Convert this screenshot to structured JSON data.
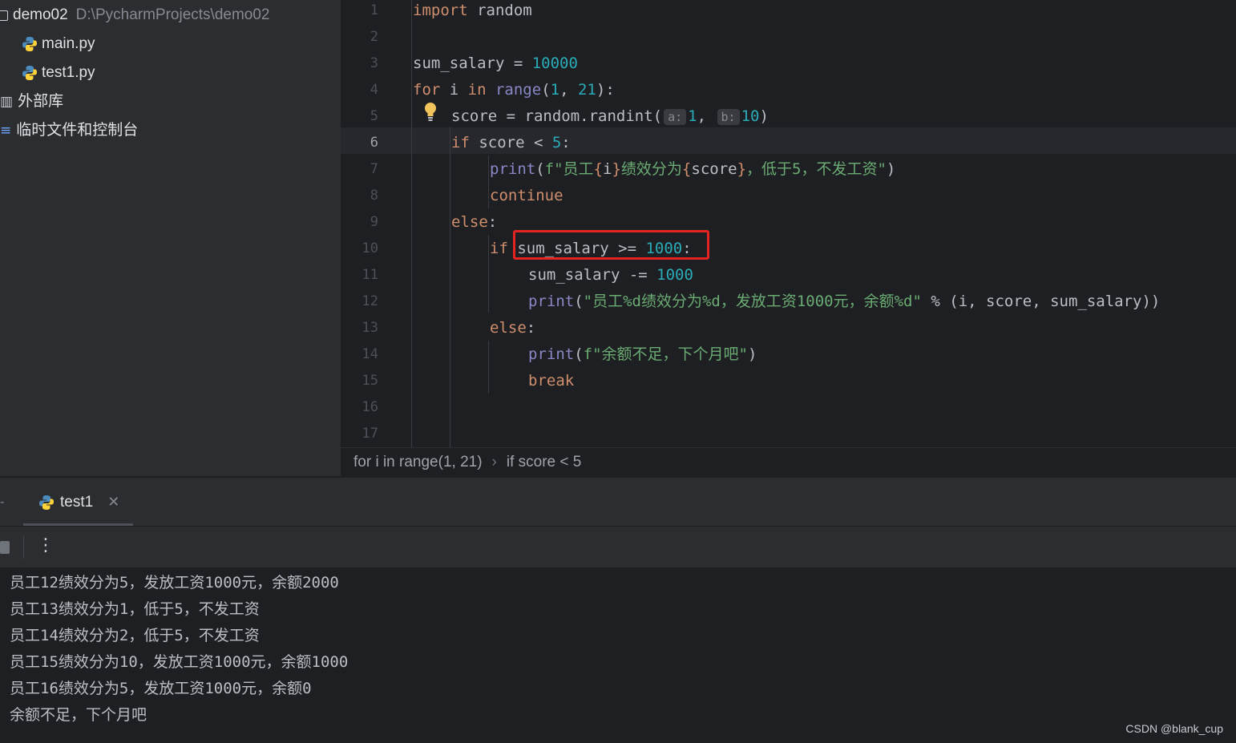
{
  "project": {
    "root_name": "demo02",
    "root_path": "D:\\PycharmProjects\\demo02",
    "files": [
      "main.py",
      "test1.py"
    ],
    "external_libraries": "外部库",
    "scratches": "临时文件和控制台"
  },
  "editor": {
    "line_numbers": [
      "1",
      "2",
      "3",
      "4",
      "5",
      "6",
      "7",
      "8",
      "9",
      "10",
      "11",
      "12",
      "13",
      "14",
      "15",
      "16",
      "17"
    ],
    "active_line": "6",
    "code": {
      "l1_kw": "import",
      "l1_rest": " random",
      "l3_var": "sum_salary",
      "l3_op": " = ",
      "l3_num": "10000",
      "l4_for": "for",
      "l4_i": " i ",
      "l4_in": "in",
      "l4_range": " range",
      "l4_open": "(",
      "l4_n1": "1",
      "l4_comma": ", ",
      "l4_n2": "21",
      "l4_close": "):",
      "l5_pre": "score = random.randint(",
      "l5_hint_a": "a:",
      "l5_n1": "1",
      "l5_comma": ",",
      "l5_hint_b": "b:",
      "l5_n2": "10",
      "l5_close": ")",
      "l6_if": "if",
      "l6_mid": " score < ",
      "l6_num": "5",
      "l6_colon": ":",
      "l7_print": "print",
      "l7_open": "(",
      "l7_f": "f\"员工",
      "l7_b1": "{",
      "l7_v1": "i",
      "l7_b2": "}",
      "l7_mid": "绩效分为",
      "l7_b3": "{",
      "l7_v2": "score",
      "l7_b4": "}",
      "l7_tail": "，低于5，不发工资\"",
      "l7_close": ")",
      "l8_kw": "continue",
      "l9_kw": "else",
      "l9_colon": ":",
      "l10_if": "if",
      "l10_cond": " sum_salary >= ",
      "l10_num": "1000",
      "l10_colon": ":",
      "l11_pre": "sum_salary -= ",
      "l11_num": "1000",
      "l12_print": "print",
      "l12_open": "(",
      "l12_str": "\"员工%d绩效分为%d，发放工资1000元，余额%d\"",
      "l12_rest": " % (i, score, sum_salary))",
      "l13_kw": "else",
      "l13_colon": ":",
      "l14_print": "print",
      "l14_open": "(",
      "l14_str": "f\"余额不足，下个月吧\"",
      "l14_close": ")",
      "l15_kw": "break"
    }
  },
  "breadcrumb": [
    "for i in range(1, 21)",
    "if score < 5"
  ],
  "run_panel": {
    "tab_label": "test1",
    "output_lines": [
      "员工12绩效分为5，发放工资1000元，余额2000",
      "员工13绩效分为1，低于5，不发工资",
      "员工14绩效分为2，低于5，不发工资",
      "员工15绩效分为10，发放工资1000元，余额1000",
      "员工16绩效分为5，发放工资1000元，余额0",
      "余额不足，下个月吧"
    ]
  },
  "watermark": "CSDN @blank_cup",
  "colors": {
    "keyword": "#cf8e6d",
    "builtin": "#8888c6",
    "number": "#2aacb8",
    "string": "#6aab73",
    "highlight_box": "#e52421"
  }
}
